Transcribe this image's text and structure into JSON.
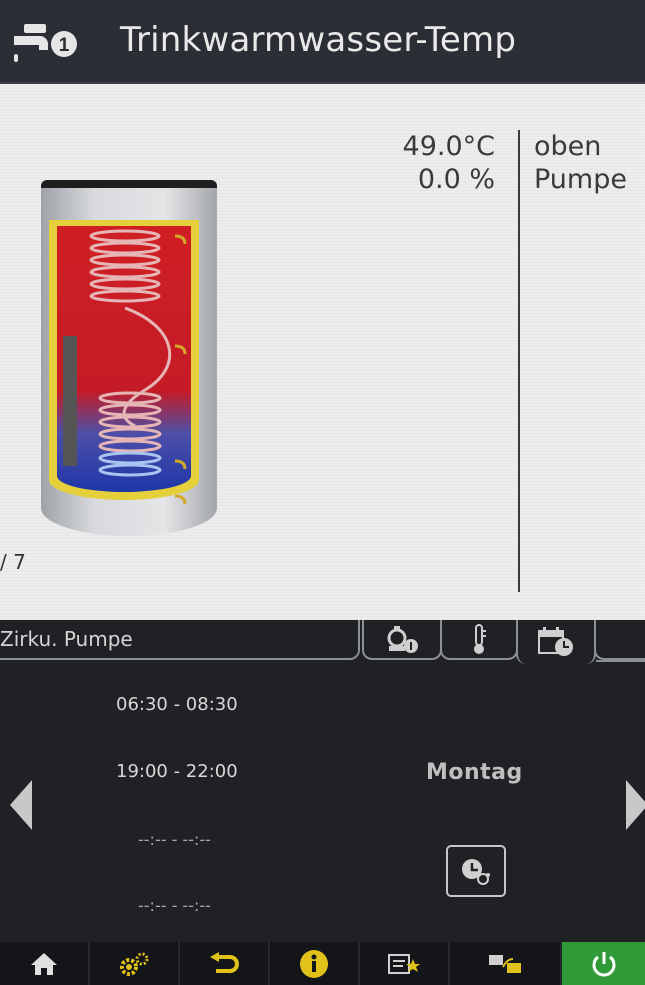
{
  "header": {
    "title": "Trinkwarmwasser-Temp",
    "icon": "tap-icon",
    "icon_badge": "1"
  },
  "readings": [
    {
      "value": "49.0°C",
      "label": "oben"
    },
    {
      "value": "0.0 %",
      "label": "Pumpe"
    }
  ],
  "page_indicator": "/ 7",
  "tabs": {
    "active_name": "Zirku. Pumpe",
    "icons": [
      "pump-info-icon",
      "thermometer-icon",
      "calendar-clock-icon"
    ]
  },
  "schedule": {
    "times": [
      "06:30 - 08:30",
      "19:00 - 22:00",
      "--:-- - --:--",
      "--:-- - --:--"
    ],
    "day": "Montag"
  },
  "bottom_nav": [
    "home-icon",
    "settings-gears-icon",
    "back-icon",
    "info-icon",
    "note-star-icon",
    "transfer-icon",
    "power-icon"
  ],
  "colors": {
    "accent_green": "#2f9a36",
    "header_bg": "#2b2e34",
    "panel_bg": "#eeeeee"
  }
}
